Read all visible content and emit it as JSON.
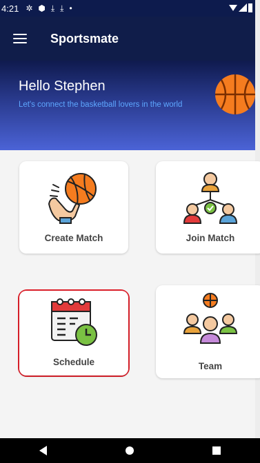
{
  "status_bar": {
    "time": "4:21",
    "icons": [
      "gear-icon",
      "shield-icon",
      "download-icon",
      "download-icon",
      "dot-icon"
    ],
    "right_icons": [
      "wifi-icon",
      "signal-icon",
      "battery-icon"
    ]
  },
  "app_bar": {
    "title": "Sportsmate",
    "menu_icon": "hamburger-menu-icon"
  },
  "hero": {
    "greeting": "Hello Stephen",
    "tagline": "Let's connect the basketball lovers in the world"
  },
  "cards": [
    {
      "label": "Create Match",
      "icon": "hand-basketball-icon"
    },
    {
      "label": "Join Match",
      "icon": "people-network-icon"
    },
    {
      "label": "Schedule",
      "icon": "calendar-clock-icon",
      "selected": true
    },
    {
      "label": "Team",
      "icon": "team-basketball-icon"
    }
  ],
  "nav_bar": [
    "back-icon",
    "home-icon",
    "recents-icon"
  ],
  "colors": {
    "app_bar": "#101d4a",
    "hero_gradient_end": "#4b63d6",
    "tagline": "#5ea7ff",
    "selection": "#e01f2a",
    "basketball": "#f57c1f"
  }
}
